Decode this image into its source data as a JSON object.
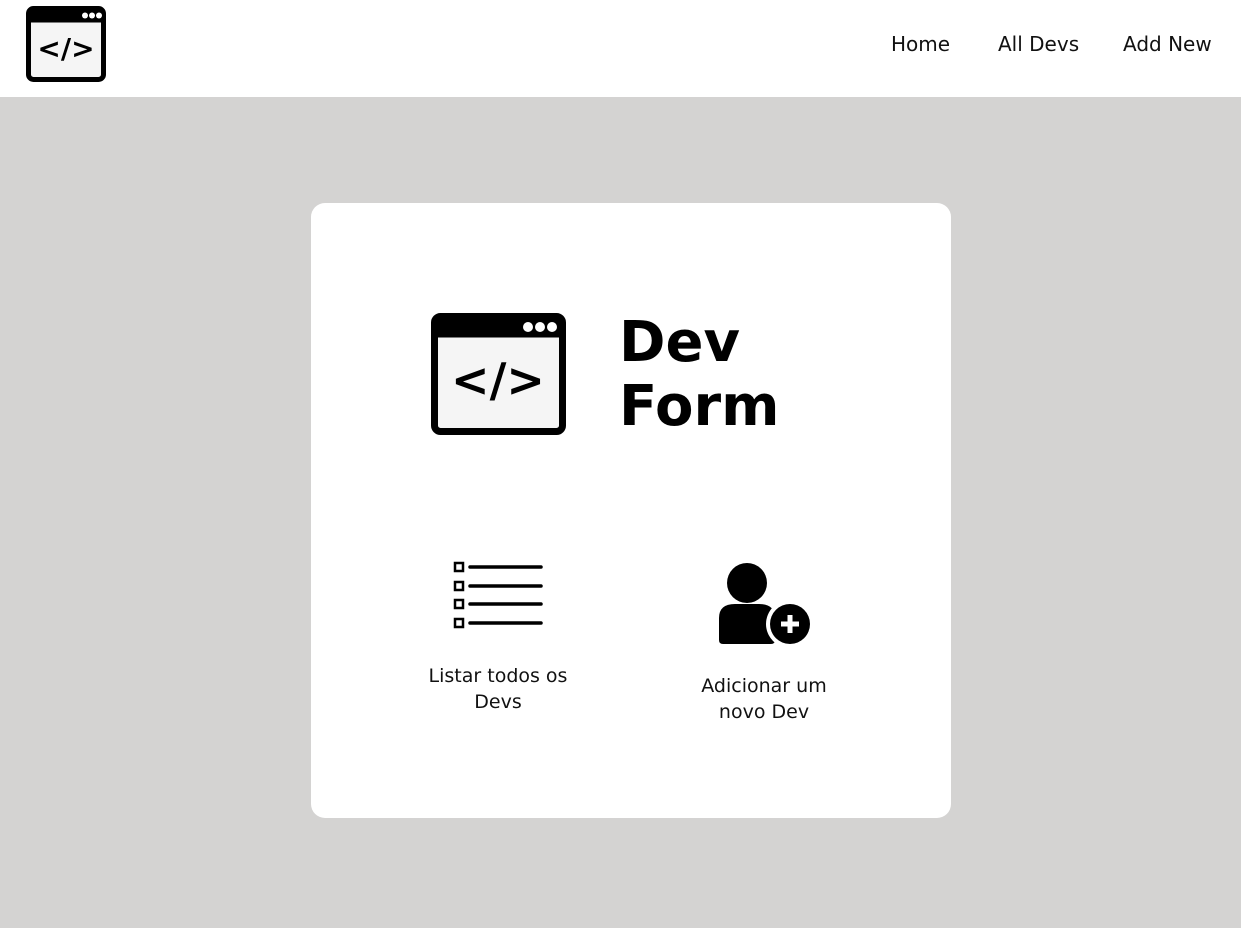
{
  "header": {
    "logo_icon": "code-window-icon",
    "nav": [
      {
        "label": "Home"
      },
      {
        "label": "All Devs"
      },
      {
        "label": "Add New"
      }
    ]
  },
  "card": {
    "icon": "code-window-icon",
    "title_line1": "Dev",
    "title_line2": "Form",
    "actions": [
      {
        "icon": "list-icon",
        "label_line1": "Listar todos os",
        "label_line2": "Devs"
      },
      {
        "icon": "add-user-icon",
        "label_line1": "Adicionar um",
        "label_line2": "novo Dev"
      }
    ]
  },
  "colors": {
    "background": "#d4d3d2",
    "surface": "#ffffff",
    "icon_fill": "#f5f5f5",
    "text": "#000000"
  }
}
